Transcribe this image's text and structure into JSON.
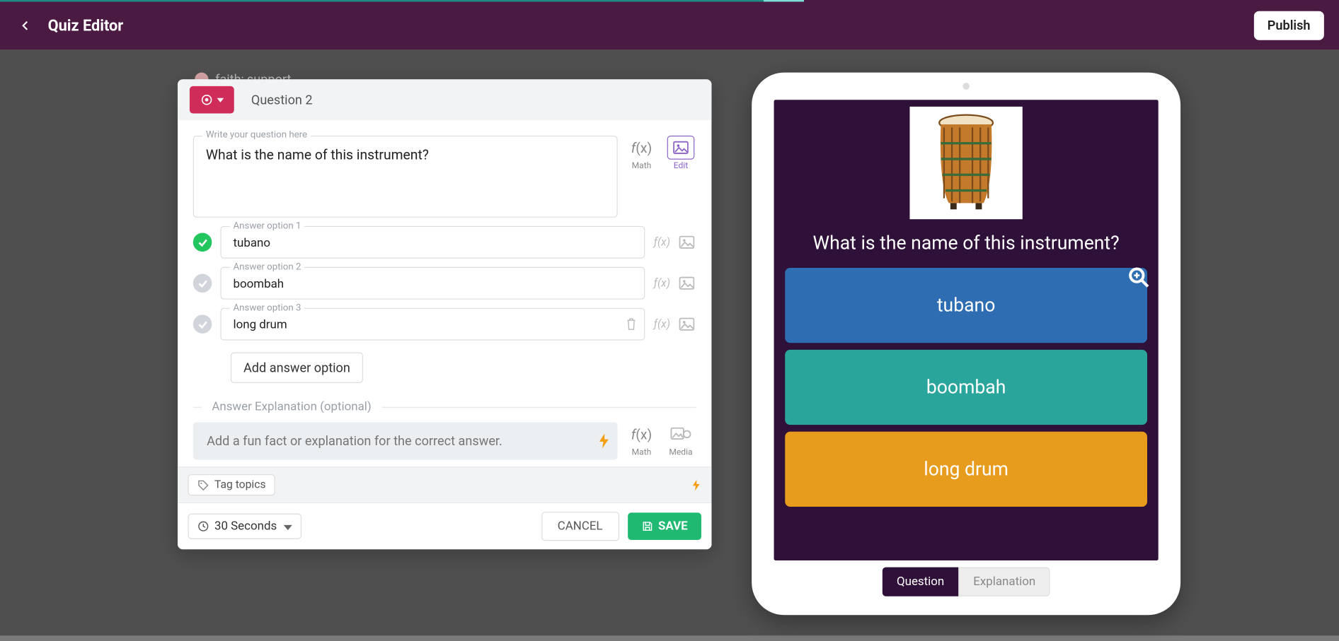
{
  "header": {
    "title": "Quiz Editor",
    "publish": "Publish"
  },
  "ghost": {
    "line": "faith; support"
  },
  "editor": {
    "question_label": "Question 2",
    "question_field_legend": "Write your question here",
    "question_text": "What is the name of this instrument?",
    "side": {
      "math_label": "Math",
      "edit_label": "Edit"
    },
    "options": [
      {
        "legend": "Answer option 1",
        "value": "tubano",
        "correct": true,
        "show_trash": false
      },
      {
        "legend": "Answer option 2",
        "value": "boombah",
        "correct": false,
        "show_trash": false
      },
      {
        "legend": "Answer option 3",
        "value": "long drum",
        "correct": false,
        "show_trash": true
      }
    ],
    "add_option": "Add answer option",
    "explanation": {
      "divider": "Answer Explanation (optional)",
      "placeholder": "Add a fun fact or explanation for the correct answer.",
      "math_label": "Math",
      "media_label": "Media"
    },
    "tag_topics": "Tag topics",
    "footer": {
      "time": "30 Seconds",
      "cancel": "CANCEL",
      "save": "SAVE"
    }
  },
  "preview": {
    "question": "What is the name of this instrument?",
    "answers": [
      "tubano",
      "boombah",
      "long drum"
    ],
    "tabs": {
      "question": "Question",
      "explanation": "Explanation"
    }
  }
}
